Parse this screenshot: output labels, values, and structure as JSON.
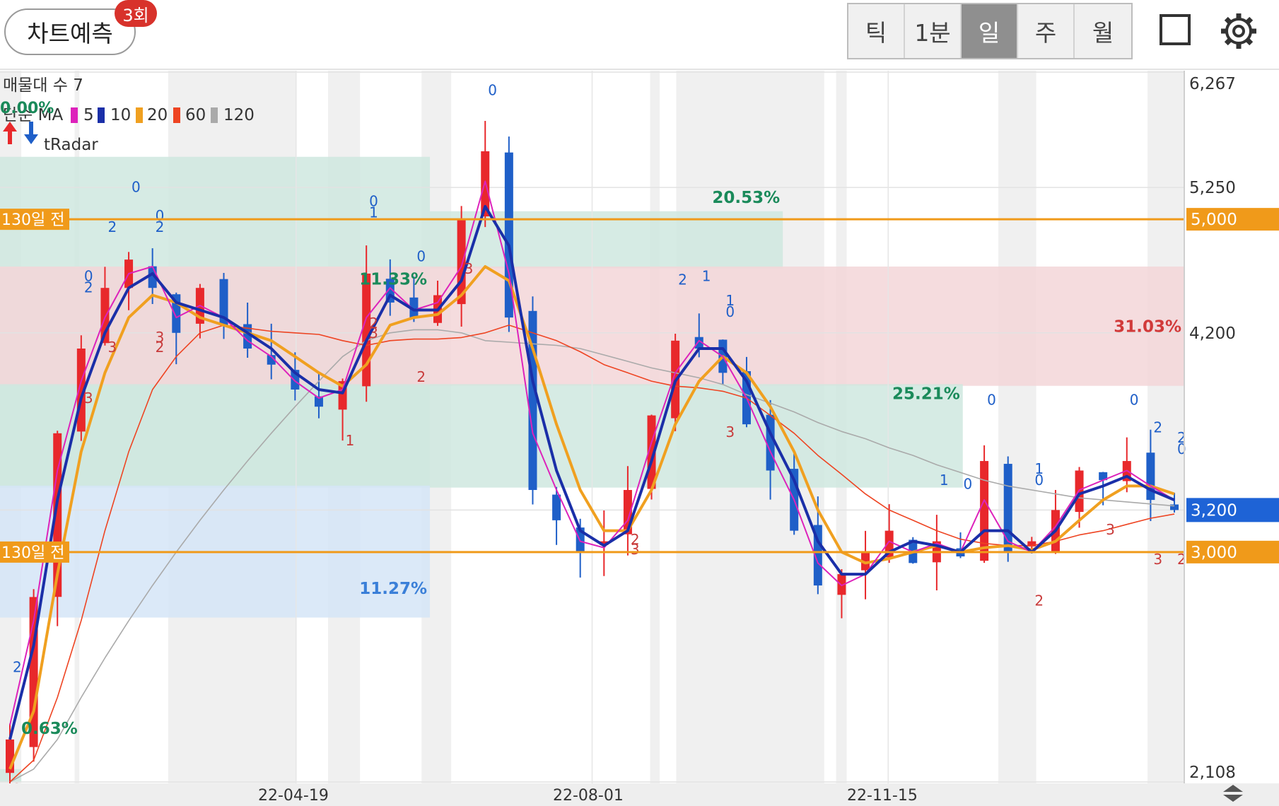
{
  "header": {
    "predict_label": "차트예측",
    "predict_badge": "3회",
    "tabs": [
      {
        "label": "틱",
        "active": false
      },
      {
        "label": "1분",
        "active": false
      },
      {
        "label": "일",
        "active": true
      },
      {
        "label": "주",
        "active": false
      },
      {
        "label": "월",
        "active": false
      }
    ],
    "square_icon": "square-icon",
    "settings_icon": "gear-icon"
  },
  "colors": {
    "up": "#e8282b",
    "down": "#1f5fc8",
    "ma5": "#dd22bb",
    "ma10": "#1a2fa8",
    "ma20": "#f0a020",
    "ma60": "#ee4422",
    "ma120": "#aaaaaa",
    "level": "#f09a1a",
    "current": "#1e63d6",
    "band_green": "#cfe7df",
    "band_red": "#f3d6d8",
    "band_blue": "#d5e5f7",
    "pct_green": "#1a8a5a",
    "pct_red": "#d13a3a",
    "pct_blue": "#3a7fd8"
  },
  "chart_data": {
    "type": "candlestick",
    "y_axis": {
      "min": 2108,
      "max": 6267,
      "scale": "log",
      "ticks": [
        "6,267",
        "5,250",
        "4,200",
        "2,108"
      ]
    },
    "x_axis": {
      "ticks": [
        "22-04-19",
        "22-08-01",
        "22-11-15"
      ]
    },
    "legend": {
      "volume_profile": "매물대 수 7",
      "ma_title": "단순 MA",
      "ma_periods": [
        "5",
        "10",
        "20",
        "60",
        "120"
      ],
      "radar": "tRadar",
      "radar_pct": "0.00%"
    },
    "levels": [
      {
        "price": 5000,
        "label": "5,000",
        "caption": "130일 전"
      },
      {
        "price": 3000,
        "label": "3,000",
        "caption": "130일 전"
      }
    ],
    "current_price": {
      "price": 3200,
      "label": "3,200"
    },
    "bands": [
      {
        "from": 3322,
        "to": 5503,
        "start": 0,
        "end": 0.363,
        "color": "green",
        "pct": "11.33%"
      },
      {
        "from": 4637,
        "to": 5062,
        "start": 0.363,
        "end": 0.661,
        "color": "green",
        "pct": "20.53%"
      },
      {
        "from": 3872,
        "to": 4650,
        "start": 0,
        "end": 1,
        "color": "red",
        "pct": "31.03%"
      },
      {
        "from": 3312,
        "to": 3882,
        "start": 0,
        "end": 0.813,
        "color": "green",
        "pct": "25.21%"
      },
      {
        "from": 2713,
        "to": 3322,
        "start": 0,
        "end": 0.363,
        "color": "blue",
        "pct": "11.27%"
      },
      {
        "from": 2108,
        "to": 2150,
        "start": 0,
        "end": 0.018,
        "color": "green",
        "pct": "0.63%"
      }
    ],
    "series": [
      {
        "name": "5",
        "values": [
          2300,
          2700,
          3400,
          3900,
          4300,
          4600,
          4650,
          4300,
          4380,
          4300,
          4150,
          4050,
          3900,
          3800,
          3850,
          4300,
          4500,
          4350,
          4400,
          4650,
          5300,
          4600,
          3600,
          3300,
          3050,
          3020,
          3150,
          3550,
          3950,
          4150,
          4050,
          3800,
          3500,
          3250,
          2950,
          2850,
          2900,
          3050,
          3000,
          3040,
          3000,
          3250,
          3050,
          3000,
          3120,
          3300,
          3350,
          3400,
          3320,
          3250
        ]
      },
      {
        "name": "10",
        "values": [
          2250,
          2600,
          3250,
          3800,
          4200,
          4500,
          4600,
          4400,
          4350,
          4300,
          4200,
          4100,
          3950,
          3850,
          3830,
          4150,
          4450,
          4350,
          4350,
          4550,
          5100,
          4800,
          3900,
          3400,
          3100,
          3030,
          3100,
          3450,
          3900,
          4100,
          4100,
          3900,
          3600,
          3350,
          3050,
          2900,
          2900,
          3000,
          3050,
          3030,
          3000,
          3100,
          3100,
          3000,
          3100,
          3280,
          3320,
          3370,
          3300,
          3250
        ]
      },
      {
        "name": "20",
        "values": [
          2150,
          2350,
          2900,
          3500,
          3950,
          4300,
          4450,
          4400,
          4300,
          4250,
          4200,
          4150,
          4050,
          3950,
          3870,
          4000,
          4250,
          4300,
          4320,
          4450,
          4650,
          4550,
          4100,
          3650,
          3300,
          3100,
          3100,
          3300,
          3650,
          3900,
          4050,
          3950,
          3750,
          3500,
          3200,
          3000,
          2950,
          2970,
          3000,
          3030,
          3000,
          3020,
          3030,
          3010,
          3050,
          3150,
          3250,
          3320,
          3320,
          3280
        ]
      },
      {
        "name": "60",
        "values": [
          2108,
          2180,
          2400,
          2700,
          3100,
          3500,
          3850,
          4050,
          4200,
          4250,
          4230,
          4210,
          4200,
          4190,
          4150,
          4120,
          4150,
          4160,
          4160,
          4170,
          4200,
          4250,
          4200,
          4150,
          4080,
          4000,
          3950,
          3900,
          3870,
          3860,
          3840,
          3800,
          3700,
          3600,
          3480,
          3380,
          3280,
          3200,
          3150,
          3100,
          3060,
          3040,
          3030,
          3030,
          3050,
          3080,
          3100,
          3130,
          3160,
          3180
        ]
      },
      {
        "name": "120",
        "values": [
          2108,
          2150,
          2250,
          2400,
          2550,
          2700,
          2850,
          3000,
          3150,
          3300,
          3450,
          3600,
          3750,
          3900,
          4050,
          4150,
          4200,
          4220,
          4220,
          4200,
          4150,
          4140,
          4130,
          4120,
          4100,
          4060,
          4020,
          3980,
          3950,
          3920,
          3880,
          3820,
          3770,
          3720,
          3660,
          3610,
          3570,
          3520,
          3480,
          3430,
          3390,
          3350,
          3320,
          3300,
          3280,
          3260,
          3250,
          3240,
          3230,
          3220
        ]
      }
    ],
    "candles_close": [
      2250,
      2800,
      3600,
      4100,
      4500,
      4700,
      4500,
      4200,
      4500,
      4250,
      4100,
      4000,
      3850,
      3750,
      3900,
      4600,
      4400,
      4300,
      4450,
      5000,
      5550,
      4300,
      3300,
      3150,
      3000,
      3050,
      3300,
      3700,
      4150,
      4100,
      3950,
      3650,
      3400,
      3100,
      2850,
      2900,
      3000,
      3100,
      2950,
      3050,
      2980,
      3450,
      3000,
      3050,
      3200,
      3400,
      3350,
      3450,
      3250,
      3200
    ],
    "annotations": [
      {
        "text": "2",
        "i": 4,
        "kind": "blue"
      },
      {
        "text": "0",
        "i": 5,
        "kind": "blue"
      },
      {
        "text": "2",
        "i": 6,
        "kind": "blue"
      },
      {
        "text": "0",
        "i": 6,
        "kind": "blue"
      },
      {
        "text": "2",
        "i": 3,
        "kind": "blue"
      },
      {
        "text": "0",
        "i": 3,
        "kind": "blue"
      },
      {
        "text": "3",
        "i": 3,
        "kind": "red"
      },
      {
        "text": "3",
        "i": 4,
        "kind": "red"
      },
      {
        "text": "3",
        "i": 6,
        "kind": "red"
      },
      {
        "text": "2",
        "i": 6,
        "kind": "red"
      },
      {
        "text": "1",
        "i": 15,
        "kind": "blue"
      },
      {
        "text": "0",
        "i": 15,
        "kind": "blue"
      },
      {
        "text": "0",
        "i": 17,
        "kind": "blue"
      },
      {
        "text": "3",
        "i": 15,
        "kind": "red"
      },
      {
        "text": "2",
        "i": 15,
        "kind": "red"
      },
      {
        "text": "2",
        "i": 17,
        "kind": "red"
      },
      {
        "text": "3",
        "i": 19,
        "kind": "red"
      },
      {
        "text": "1",
        "i": 14,
        "kind": "red"
      },
      {
        "text": "0",
        "i": 20,
        "kind": "blue"
      },
      {
        "text": "1",
        "i": 29,
        "kind": "blue"
      },
      {
        "text": "2",
        "i": 28,
        "kind": "blue"
      },
      {
        "text": "1",
        "i": 30,
        "kind": "blue"
      },
      {
        "text": "0",
        "i": 30,
        "kind": "blue"
      },
      {
        "text": "3",
        "i": 30,
        "kind": "red"
      },
      {
        "text": "2",
        "i": 26,
        "kind": "red"
      },
      {
        "text": "3",
        "i": 26,
        "kind": "red"
      },
      {
        "text": "1",
        "i": 39,
        "kind": "blue"
      },
      {
        "text": "0",
        "i": 40,
        "kind": "blue"
      },
      {
        "text": "0",
        "i": 41,
        "kind": "blue"
      },
      {
        "text": "1",
        "i": 43,
        "kind": "blue"
      },
      {
        "text": "0",
        "i": 43,
        "kind": "blue"
      },
      {
        "text": "2",
        "i": 43,
        "kind": "red"
      },
      {
        "text": "3",
        "i": 46,
        "kind": "red"
      },
      {
        "text": "2",
        "i": 48,
        "kind": "blue"
      },
      {
        "text": "0",
        "i": 47,
        "kind": "blue"
      },
      {
        "text": "2",
        "i": 49,
        "kind": "blue"
      },
      {
        "text": "0",
        "i": 49,
        "kind": "blue"
      },
      {
        "text": "3",
        "i": 48,
        "kind": "red"
      },
      {
        "text": "2",
        "i": 49,
        "kind": "red"
      },
      {
        "text": "2",
        "i": 0,
        "kind": "blue"
      },
      {
        "text": "3",
        "i": 0,
        "kind": "red"
      }
    ]
  }
}
